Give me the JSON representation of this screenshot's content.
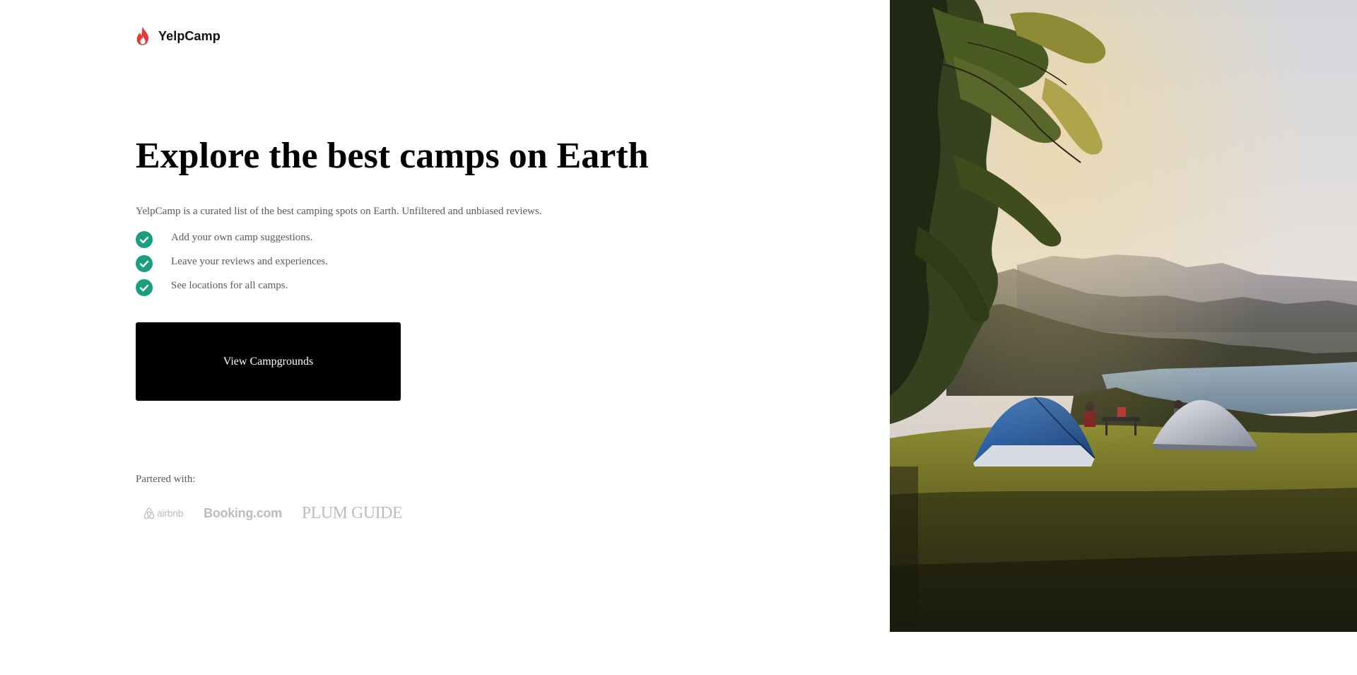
{
  "brand": {
    "name": "YelpCamp",
    "icon": "flame-icon",
    "icon_color": "#e53b3b"
  },
  "hero": {
    "title": "Explore the best camps on Earth",
    "description": "YelpCamp is a curated list of the best camping spots on Earth. Unfiltered and unbiased reviews.",
    "features": [
      "Add your own camp suggestions.",
      "Leave your reviews and experiences.",
      "See locations for all camps."
    ],
    "feature_icon": "check-circle-icon",
    "feature_icon_color": "#1a9e80",
    "cta_label": "View Campgrounds"
  },
  "partners": {
    "label": "Partered with:",
    "logos": [
      "airbnb",
      "Booking.com",
      "PLUM GUIDE"
    ]
  },
  "image": {
    "subject": "camping-tents-mountain-lake-photo"
  },
  "colors": {
    "text_primary": "#000000",
    "text_muted": "#555b66",
    "button_bg": "#000000",
    "button_text": "#ffffff",
    "partner_logo": "#b9bdc3"
  }
}
